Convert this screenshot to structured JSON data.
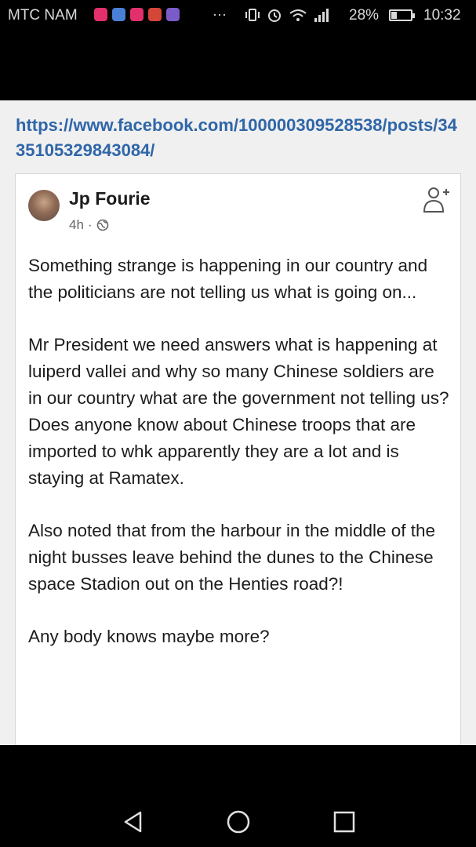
{
  "status_bar": {
    "carrier": "MTC NAM",
    "overflow": "···",
    "battery_percent": "28%",
    "battery_level": 0.28,
    "time": "10:32",
    "notification_icons": [
      "instagram-icon",
      "drive-icon",
      "instagram-icon",
      "gmail-icon",
      "app-icon"
    ],
    "system_icons": [
      "vibrate-icon",
      "alarm-icon",
      "wifi-icon",
      "signal-icon",
      "battery-icon"
    ]
  },
  "link": {
    "url": "https://www.facebook.com/100000309528538/posts/3435105329843084/"
  },
  "post": {
    "author": "Jp Fourie",
    "time": "4h",
    "separator": "·",
    "privacy_icon": "globe-icon",
    "follow_icon": "add-friend-icon",
    "paragraphs": [
      "Something strange is happening in our country and the politicians are not telling us what is going on...",
      "Mr President we need answers what is happening at luiperd vallei and why so many Chinese soldiers are in our country what are the government not telling us?\nDoes anyone know about Chinese troops that are imported to whk apparently they are a lot and is staying at Ramatex.",
      "Also noted that from the harbour in the middle of the night busses leave behind the dunes to the Chinese space Stadion out on the Henties road?!",
      "Any body knows maybe more?"
    ]
  },
  "nav_bar": {
    "buttons": [
      "back-icon",
      "home-icon",
      "recents-icon"
    ]
  }
}
